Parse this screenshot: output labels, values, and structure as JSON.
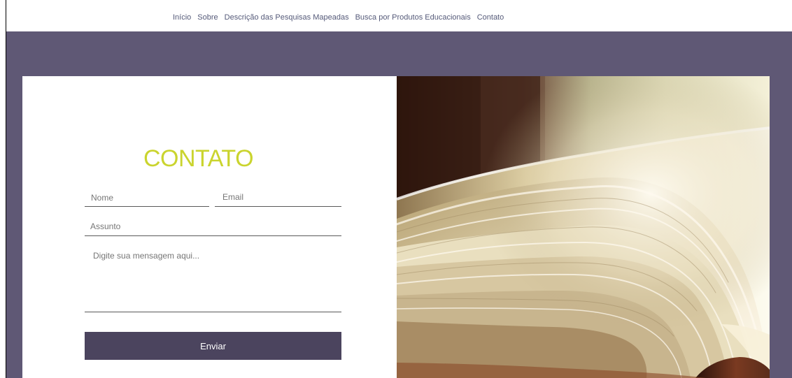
{
  "navigation": {
    "items": [
      {
        "label": "Início"
      },
      {
        "label": "Sobre"
      },
      {
        "label": "Descrição das Pesquisas Mapeadas"
      },
      {
        "label": "Busca por Produtos Educacionais"
      },
      {
        "label": "Contato"
      }
    ]
  },
  "contact_form": {
    "title": "CONTATO",
    "name": {
      "value": "",
      "placeholder": "Nome"
    },
    "email": {
      "value": "",
      "placeholder": "Email"
    },
    "subject": {
      "value": "",
      "placeholder": "Assunto"
    },
    "message": {
      "value": "",
      "placeholder": "Digite sua mensagem aqui..."
    },
    "submit_label": "Enviar"
  },
  "image": {
    "subject": "open-book-photo"
  },
  "colors": {
    "hero_background": "#5f5875",
    "title_accent": "#cad42e",
    "button_background": "#4b445e",
    "navigation_text": "#555a79"
  }
}
